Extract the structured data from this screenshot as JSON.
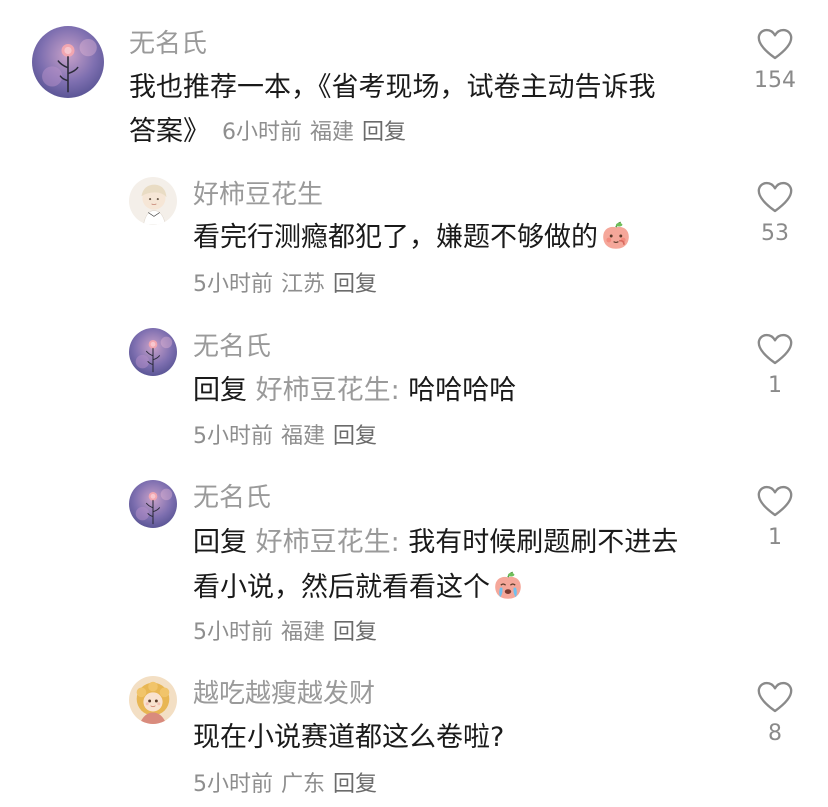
{
  "comments": [
    {
      "username": "无名氏",
      "text_line1": "我也推荐一本，《省考现场，试卷主动告诉我",
      "text_line2": "答案》",
      "time": "6小时前",
      "location": "福建",
      "reply_label": "回复",
      "likes": "154"
    },
    {
      "username": "好柿豆花生",
      "text": "看完行测瘾都犯了，嫌题不够做的",
      "emoji": "peach-blush-emoji",
      "time": "5小时前",
      "location": "江苏",
      "reply_label": "回复",
      "likes": "53"
    },
    {
      "username": "无名氏",
      "reply_word": "回复",
      "reply_target": "好柿豆花生:",
      "text": "哈哈哈哈",
      "time": "5小时前",
      "location": "福建",
      "reply_label": "回复",
      "likes": "1"
    },
    {
      "username": "无名氏",
      "reply_word": "回复",
      "reply_target": "好柿豆花生:",
      "text_line1": "我有时候刷题刷不进去",
      "text_line2": "看小说，然后就看看这个",
      "emoji": "peach-crying-emoji",
      "time": "5小时前",
      "location": "福建",
      "reply_label": "回复",
      "likes": "1"
    },
    {
      "username": "越吃越瘦越发财",
      "text": "现在小说赛道都这么卷啦?",
      "time": "5小时前",
      "location": "广东",
      "reply_label": "回复",
      "likes": "8"
    }
  ],
  "colors": {
    "username": "#9a9a9a",
    "text": "#1a1a1a",
    "meta": "#8e8e8e",
    "heart_stroke": "#8a8a8a"
  }
}
